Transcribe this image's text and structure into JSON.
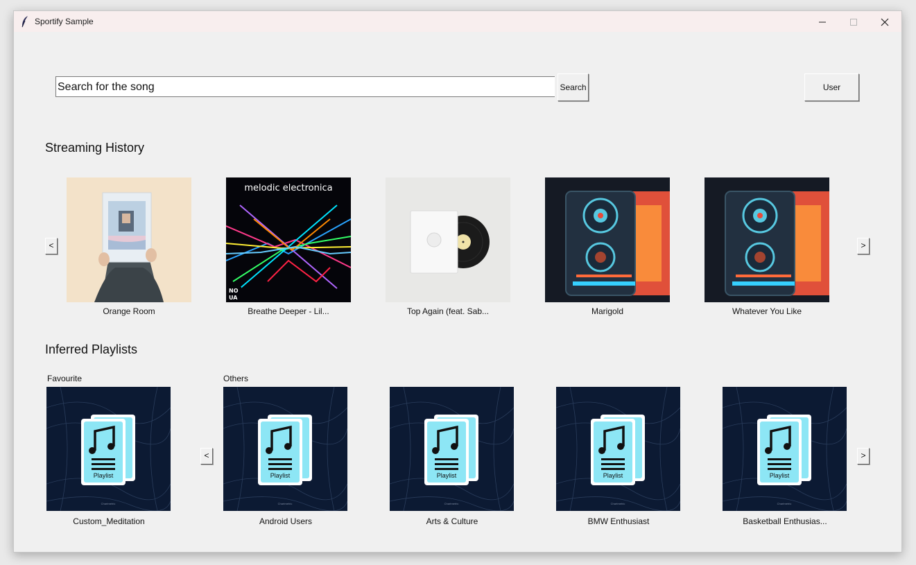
{
  "window": {
    "title": "Sportify Sample",
    "controls": [
      "minimize-icon",
      "maximize-icon",
      "close-icon"
    ]
  },
  "search": {
    "value": "Search for the song",
    "button_label": "Search"
  },
  "user_button": {
    "label": "User"
  },
  "streaming_history": {
    "title": "Streaming History",
    "prev_label": "<",
    "next_label": ">",
    "items": [
      {
        "label": "Orange Room",
        "art": "person-holding-photo"
      },
      {
        "label": "Breathe Deeper - Lil...",
        "art": "melodic-electronica-cover"
      },
      {
        "label": "Top Again (feat. Sab...",
        "art": "vinyl-record"
      },
      {
        "label": "Marigold",
        "art": "speaker-art"
      },
      {
        "label": "Whatever You Like",
        "art": "speaker-art"
      }
    ],
    "cover_text": {
      "melodic": "melodic electronica",
      "noua_top": "NO",
      "noua_bottom": "UA"
    }
  },
  "inferred_playlists": {
    "title": "Inferred Playlists",
    "favourite_label": "Favourite",
    "others_label": "Others",
    "prev_label": "<",
    "next_label": ">",
    "favourite": {
      "label": "Custom_Meditation"
    },
    "others": [
      {
        "label": "Android Users"
      },
      {
        "label": "Arts & Culture"
      },
      {
        "label": "BMW Enthusiast"
      },
      {
        "label": "Basketball Enthusias..."
      }
    ],
    "playlist_icon_text": "Playlist",
    "brand_mark": "Chartmetric"
  },
  "colors": {
    "window_bg": "#f0f0f0",
    "titlebar_bg": "#f8eeee",
    "playlist_bg": "#0c1a33",
    "playlist_card": "#8de6f5"
  }
}
